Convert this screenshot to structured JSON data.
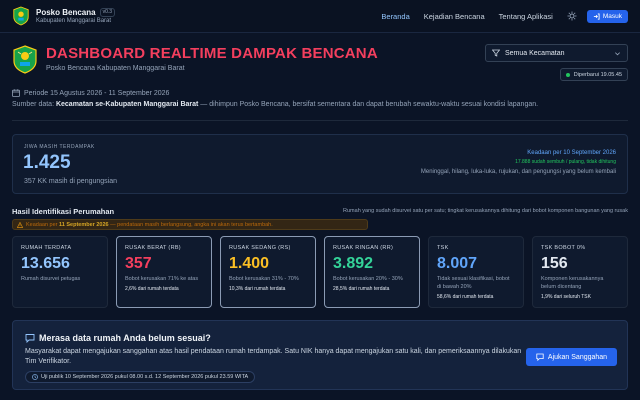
{
  "nav": {
    "title": "Posko Bencana",
    "badge": "v0.3",
    "subtitle": "Kabupaten Manggarai Barat",
    "links": [
      "Beranda",
      "Kejadian Bencana",
      "Tentang Aplikasi"
    ],
    "login_label": "Masuk"
  },
  "header": {
    "title": "DASHBOARD REALTIME DAMPAK BENCANA",
    "subtitle": "Posko Bencana Kabupaten Manggarai Barat",
    "filter_value": "Semua Kecamatan",
    "updated": "Diperbarui 19.05.45"
  },
  "info": {
    "period": "Periode 15 Agustus 2026 - 11 September 2026",
    "source_prefix": "Sumber data: ",
    "source_bold": "Kecamatan se-Kabupaten Manggarai Barat",
    "source_suffix": " — dihimpun Posko Bencana, bersifat sementara dan dapat berubah sewaktu-waktu sesuai kondisi lapangan."
  },
  "people": {
    "label": "JIWA MASIH TERDAMPAK",
    "value": "1.425",
    "sub": "357 KK masih di pengungsian",
    "as_of": "Keadaan per 10 September 2026",
    "extra": "17.888 sudah sembuh / pulang, tidak dihitung",
    "desc": "Meninggal, hilang, luka-luka, rujukan, dan pengungsi yang belum kembali"
  },
  "housing": {
    "title": "Hasil Identifikasi Perumahan",
    "note": "Rumah yang sudah disurvei satu per satu; tingkat kerusakannya dihitung dari bobot komponen bangunan yang rusak",
    "notice_prefix": "Keadaan per ",
    "notice_bold": "11 September 2026",
    "notice_suffix": " — pendataan masih berlangsung, angka ini akan terus bertambah."
  },
  "stats": [
    {
      "label": "RUMAH TERDATA",
      "value": "13.656",
      "desc": "Rumah disurvei petugas",
      "foot": "",
      "color": "#93c5fd",
      "highlight": false
    },
    {
      "label": "RUSAK BERAT (RB)",
      "value": "357",
      "desc": "Bobot kerusakan 71% ke atas",
      "foot": "2,6% dari rumah terdata",
      "color": "#f43f5e",
      "highlight": true
    },
    {
      "label": "RUSAK SEDANG (RS)",
      "value": "1.400",
      "desc": "Bobot kerusakan 31% - 70%",
      "foot": "10,3% dari rumah terdata",
      "color": "#fbbf24",
      "highlight": true
    },
    {
      "label": "RUSAK RINGAN (RR)",
      "value": "3.892",
      "desc": "Bobot kerusakan 20% - 30%",
      "foot": "28,5% dari rumah terdata",
      "color": "#34d399",
      "highlight": true
    },
    {
      "label": "TSK",
      "value": "8.007",
      "desc": "Tidak sesuai klasifikasi, bobot di bawah 20%",
      "foot": "58,6% dari rumah terdata",
      "color": "#60a5fa",
      "highlight": false
    },
    {
      "label": "TSK BOBOT 0%",
      "value": "156",
      "desc": "Komponen kerusakannya belum dicentang",
      "foot": "1,9% dari seluruh TSK",
      "color": "#e2e8f0",
      "highlight": false
    }
  ],
  "appeal": {
    "title": "Merasa data rumah Anda belum sesuai?",
    "text": "Masyarakat dapat mengajukan sanggahan atas hasil pendataan rumah terdampak. Satu NIK hanya dapat mengajukan satu kali, dan pemeriksaannya dilakukan Tim Verifikator.",
    "schedule": "Uji publik 10 September 2026 pukul 08.00 s.d. 12 September 2026 pukul 23.59 WITA",
    "button": "Ajukan Sanggahan"
  }
}
